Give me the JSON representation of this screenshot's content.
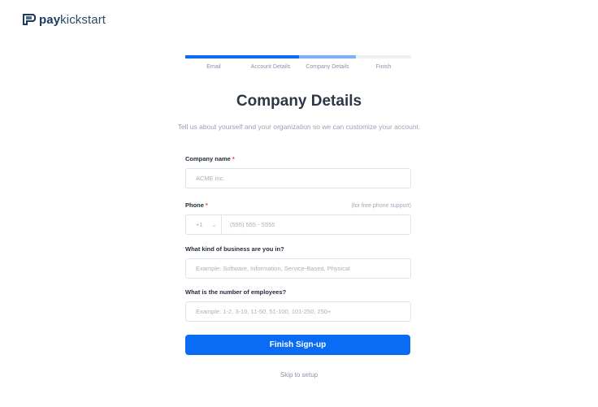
{
  "brand": {
    "pay": "pay",
    "kickstart": "kickstart",
    "color": "#1b3a5c"
  },
  "stepper": {
    "steps": [
      {
        "label": "Email",
        "state": "complete",
        "color": "#0a6cf5"
      },
      {
        "label": "Account Details",
        "state": "complete",
        "color": "#0a6cf5"
      },
      {
        "label": "Company Details",
        "state": "active",
        "color": "#7fb0f5"
      },
      {
        "label": "Finish",
        "state": "pending",
        "color": "#eef0f4"
      }
    ]
  },
  "page": {
    "title": "Company Details",
    "subtitle": "Tell us about yourself and your organization so we can customize your account."
  },
  "form": {
    "company": {
      "label": "Company name",
      "required": "*",
      "placeholder": "ACME inc."
    },
    "phone": {
      "label": "Phone",
      "required": "*",
      "hint": "(for free phone support)",
      "country_code": "+1",
      "placeholder": "(555) 555 - 5555"
    },
    "business": {
      "label": "What kind of business are you in?",
      "placeholder": "Example: Software, Information, Service-Based, Physical"
    },
    "employees": {
      "label": "What is the number of employees?",
      "placeholder": "Example: 1-2, 3-10, 11-50, 51-100, 101-250, 250+"
    }
  },
  "actions": {
    "submit_label": "Finish Sign-up",
    "skip_label": "Skip to setup",
    "accent": "#0a6cf5"
  }
}
